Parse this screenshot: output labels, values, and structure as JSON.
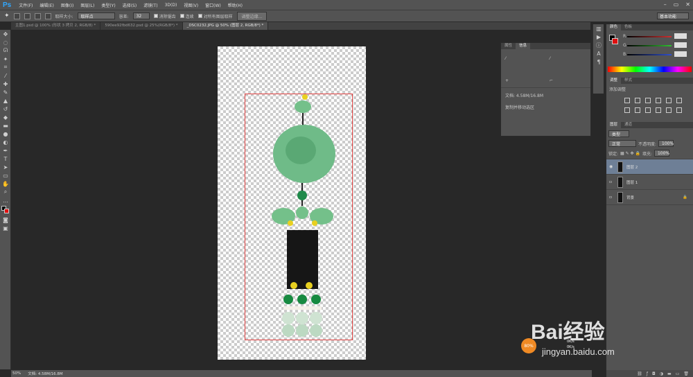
{
  "app": {
    "logo": "Ps"
  },
  "menu": [
    "文件(F)",
    "编辑(E)",
    "图像(I)",
    "图层(L)",
    "类型(Y)",
    "选择(S)",
    "滤镜(T)",
    "3D(D)",
    "视图(V)",
    "窗口(W)",
    "帮助(H)"
  ],
  "window_controls": [
    "–",
    "▭",
    "✕"
  ],
  "options": {
    "sample_size_label": "取样大小:",
    "sample_size_value": "取样点",
    "tolerance_label": "容差:",
    "tolerance_value": "32",
    "antialias": "消除锯齿",
    "contiguous": "连续",
    "sample_all": "对所有图层取样",
    "refine_edge": "调整边缘...",
    "workspace": "基本功能"
  },
  "tabs": [
    "主图1.psd @ 100% (形状 3 拷贝 2, RGB/8) *",
    "590ee92fbd632.psd @ 25%(RGB/8*) *",
    "_DSC0232.JPG @ 50% (图层 2, RGB/8*) *"
  ],
  "info_panel": {
    "tabs": [
      "属性",
      "信息"
    ],
    "file_size": "文档: 4.58M/16.8M",
    "hint": "复制并移动选区"
  },
  "color_panel": {
    "tabs": [
      "颜色",
      "色板"
    ],
    "channels": [
      "R",
      "G",
      "B"
    ],
    "colors": {
      "R": "#d03030",
      "G": "#30c030",
      "B": "#3050d0"
    }
  },
  "adjust_panel": {
    "tabs": [
      "调整",
      "样式"
    ],
    "title": "添加调整"
  },
  "layers_panel": {
    "tabs": [
      "图层",
      "通道"
    ],
    "kind": "类型",
    "blend": "正常",
    "opacity_label": "不透明度:",
    "opacity": "100%",
    "lock_label": "锁定:",
    "fill_label": "填充:",
    "fill": "100%",
    "layers": [
      {
        "name": "图层 2",
        "selected": true,
        "visible": true
      },
      {
        "name": "图层 1",
        "selected": false,
        "visible": false
      },
      {
        "name": "背景",
        "selected": false,
        "visible": false,
        "locked": true
      }
    ]
  },
  "status": {
    "zoom": "50%",
    "doc": "文档: 4.58M/16.8M"
  },
  "watermark": {
    "main": "Bai经验",
    "sub": "jingyan.baidu.com",
    "percent": "80%",
    "rate1": "0K/s",
    "rate2": "0K/s"
  }
}
